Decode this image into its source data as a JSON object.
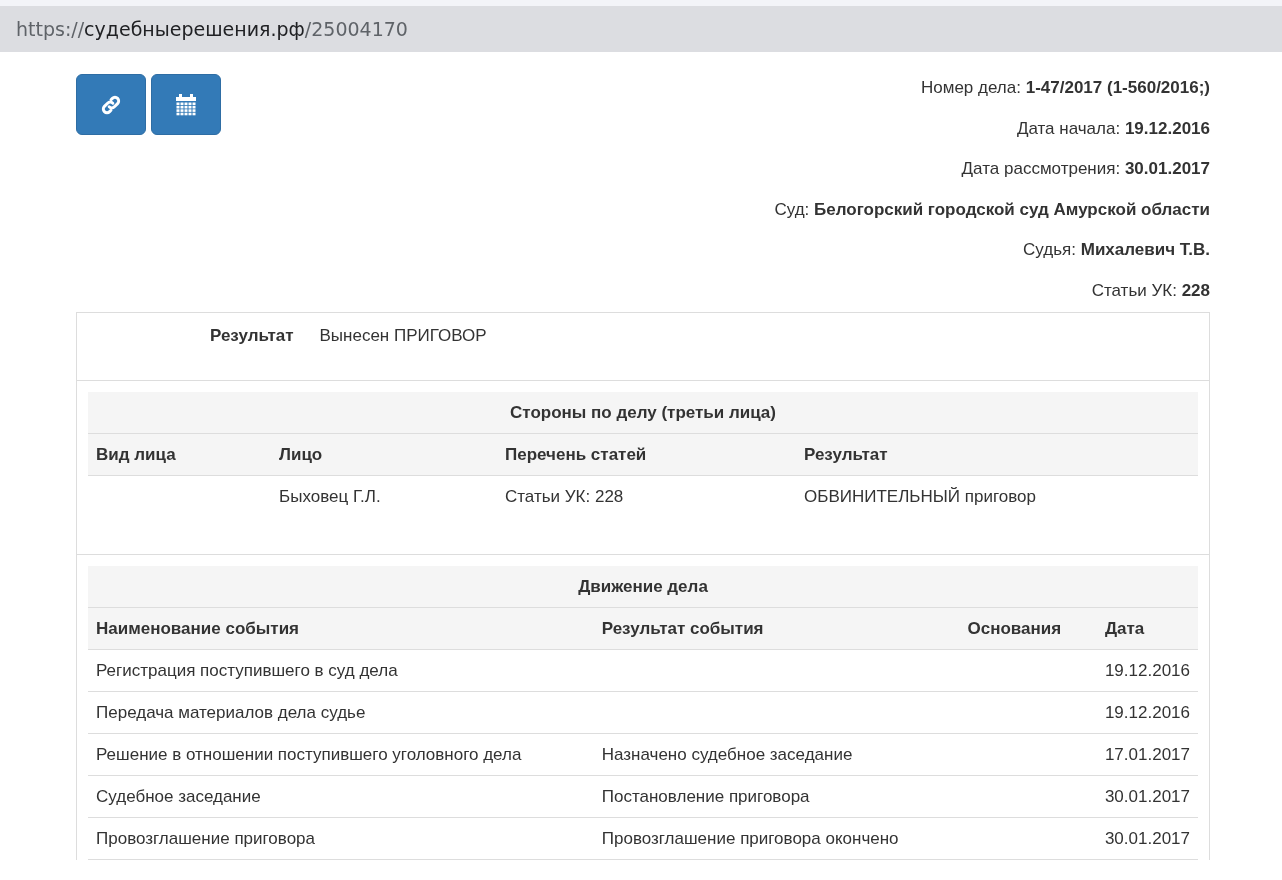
{
  "address_bar": {
    "scheme": "https://",
    "host": "судебныерешения.рф",
    "path": "/25004170"
  },
  "info": [
    {
      "label": "Номер дела:",
      "value": "1-47/2017 (1-560/2016;)"
    },
    {
      "label": "Дата начала:",
      "value": "19.12.2016"
    },
    {
      "label": "Дата рассмотрения:",
      "value": "30.01.2017"
    },
    {
      "label": "Суд:",
      "value": "Белогорский городской суд Амурской области"
    },
    {
      "label": "Судья:",
      "value": "Михалевич Т.В."
    },
    {
      "label": "Статьи УК:",
      "value": "228"
    }
  ],
  "result": {
    "label": "Результат",
    "value": "Вынесен ПРИГОВОР"
  },
  "parties": {
    "title": "Стороны по делу (третьи лица)",
    "columns": [
      "Вид лица",
      "Лицо",
      "Перечень статей",
      "Результат"
    ],
    "rows": [
      [
        "",
        "Быховец Г.Л.",
        "Статьи УК: 228",
        "ОБВИНИТЕЛЬНЫЙ приговор"
      ]
    ]
  },
  "events": {
    "title": "Движение дела",
    "columns": [
      "Наименование события",
      "Результат события",
      "Основания",
      "Дата"
    ],
    "rows": [
      [
        "Регистрация поступившего в суд дела",
        "",
        "",
        "19.12.2016"
      ],
      [
        "Передача материалов дела судье",
        "",
        "",
        "19.12.2016"
      ],
      [
        "Решение в отношении поступившего уголовного дела",
        "Назначено судебное заседание",
        "",
        "17.01.2017"
      ],
      [
        "Судебное заседание",
        "Постановление приговора",
        "",
        "30.01.2017"
      ],
      [
        "Провозглашение приговора",
        "Провозглашение приговора окончено",
        "",
        "30.01.2017"
      ]
    ]
  }
}
